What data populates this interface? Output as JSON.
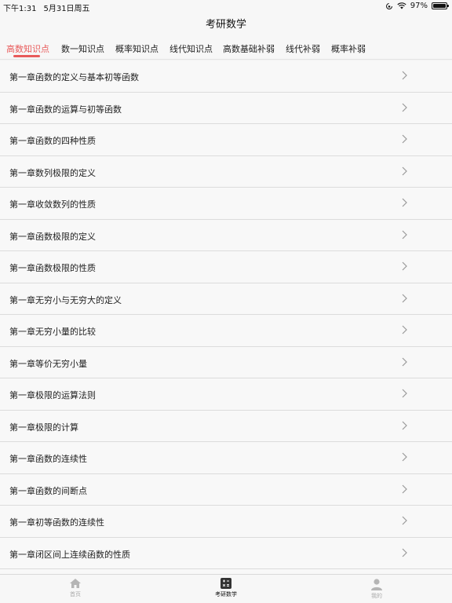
{
  "status_bar": {
    "time": "下午1:31",
    "date": "5月31日周五",
    "battery_level": "97%",
    "battery_fraction": 0.97
  },
  "nav": {
    "title": "考研数学"
  },
  "tabs": [
    {
      "label": "高数知识点",
      "active": true
    },
    {
      "label": "数一知识点",
      "active": false
    },
    {
      "label": "概率知识点",
      "active": false
    },
    {
      "label": "线代知识点",
      "active": false
    },
    {
      "label": "高数基础补弱",
      "active": false
    },
    {
      "label": "线代补弱",
      "active": false
    },
    {
      "label": "概率补弱",
      "active": false
    }
  ],
  "accent_color": "#e85a5a",
  "list": {
    "items": [
      {
        "label": "第一章函数的定义与基本初等函数"
      },
      {
        "label": "第一章函数的运算与初等函数"
      },
      {
        "label": "第一章函数的四种性质"
      },
      {
        "label": "第一章数列极限的定义"
      },
      {
        "label": "第一章收敛数列的性质"
      },
      {
        "label": "第一章函数极限的定义"
      },
      {
        "label": "第一章函数极限的性质"
      },
      {
        "label": "第一章无穷小与无穷大的定义"
      },
      {
        "label": "第一章无穷小量的比较"
      },
      {
        "label": "第一章等价无穷小量"
      },
      {
        "label": "第一章极限的运算法则"
      },
      {
        "label": "第一章极限的计算"
      },
      {
        "label": "第一章函数的连续性"
      },
      {
        "label": "第一章函数的间断点"
      },
      {
        "label": "第一章初等函数的连续性"
      },
      {
        "label": "第一章闭区间上连续函数的性质"
      }
    ]
  },
  "tabbar": {
    "items": [
      {
        "label": "首页",
        "icon": "home-icon",
        "active": false
      },
      {
        "label": "考研数学",
        "icon": "calculator-icon",
        "active": true
      },
      {
        "label": "我的",
        "icon": "person-icon",
        "active": false
      }
    ]
  }
}
